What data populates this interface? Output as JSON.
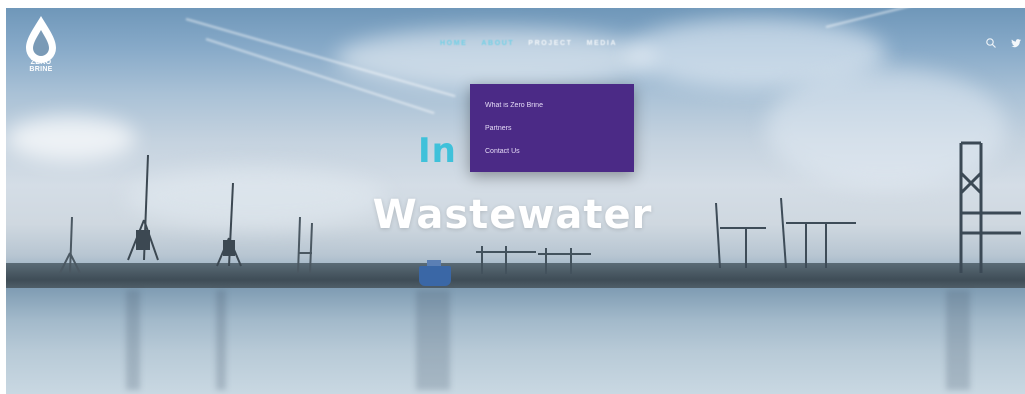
{
  "brand": {
    "logo_text": "ZERO BRINE"
  },
  "nav": {
    "items": [
      {
        "label": "HOME",
        "active": true
      },
      {
        "label": "ABOUT",
        "active": true
      },
      {
        "label": "PROJECT",
        "active": false
      },
      {
        "label": "MEDIA",
        "active": false
      }
    ]
  },
  "dropdown": {
    "items": [
      {
        "label": "What is Zero Brine"
      },
      {
        "label": "Partners"
      },
      {
        "label": "Contact Us"
      }
    ]
  },
  "hero": {
    "headline_top": "In",
    "headline": "Wastewater"
  },
  "header_icons": [
    "search-icon",
    "twitter-icon"
  ],
  "colors": {
    "accent": "#3fc1da",
    "dropdown_bg": "#4b2a86",
    "headline": "#ffffff"
  }
}
